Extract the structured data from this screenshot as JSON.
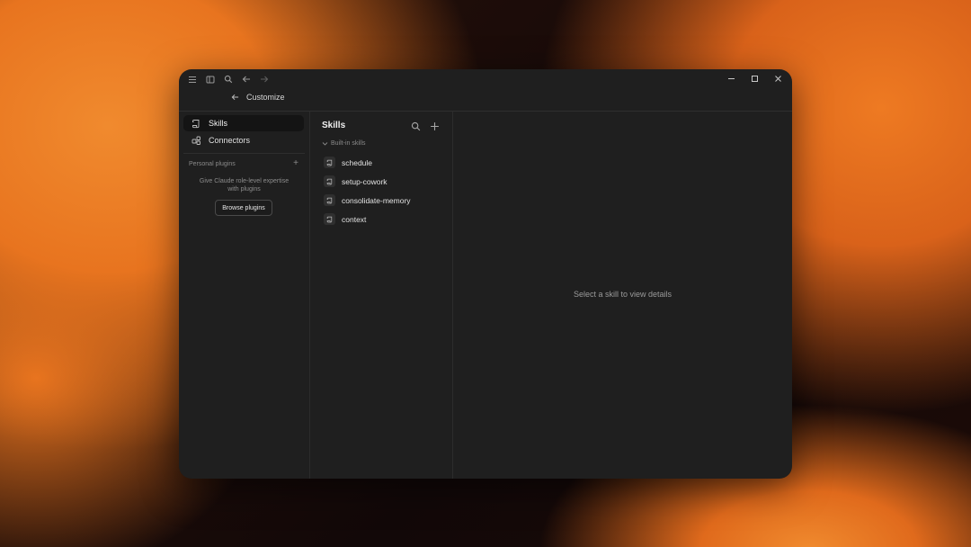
{
  "header": {
    "back_label": "Customize"
  },
  "sidebar": {
    "items": [
      {
        "label": "Skills",
        "icon": "scroll-icon",
        "active": true
      },
      {
        "label": "Connectors",
        "icon": "connectors-icon",
        "active": false
      }
    ],
    "personal_plugins": {
      "heading": "Personal plugins",
      "message_line1": "Give Claude role-level expertise",
      "message_line2": "with plugins",
      "button_label": "Browse plugins"
    }
  },
  "skills_panel": {
    "title": "Skills",
    "group_label": "Built-in skills",
    "skills": [
      "schedule",
      "setup-cowork",
      "consolidate-memory",
      "context"
    ]
  },
  "detail": {
    "empty_message": "Select a skill to view details"
  }
}
